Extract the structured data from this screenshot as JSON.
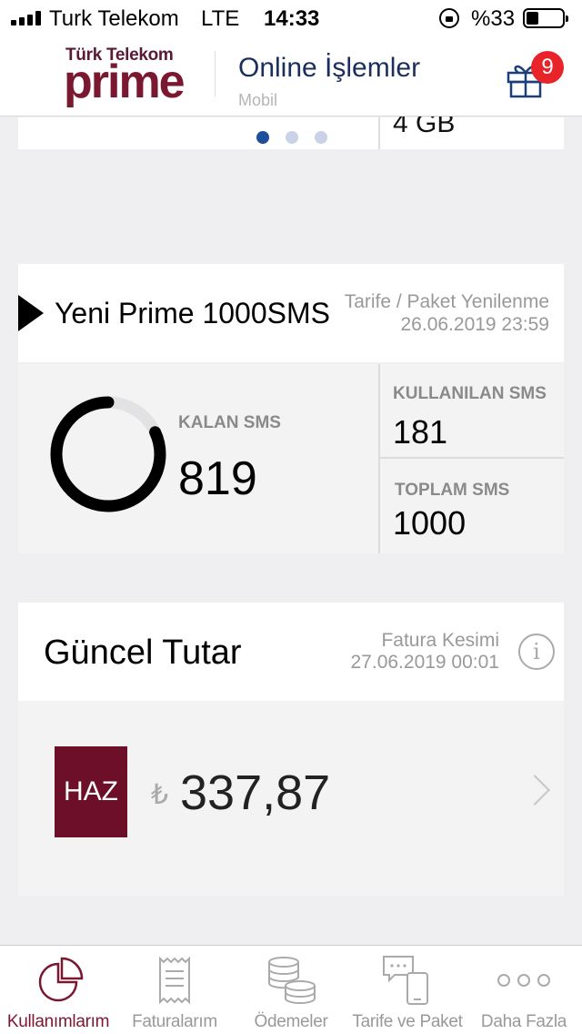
{
  "status_bar": {
    "carrier": "Turk Telekom",
    "network": "LTE",
    "time": "14:33",
    "battery": "%33",
    "battery_level": 0.33
  },
  "header": {
    "logo_top": "Türk Telekom",
    "logo_brand": "prime",
    "title": "Online İşlemler",
    "subtitle": "Mobil",
    "gift_count": "9"
  },
  "carousel": {
    "partial_value": "4 GB",
    "pages": 3,
    "active_page": 0
  },
  "sms_card": {
    "package_name": "Yeni Prime 1000SMS",
    "renewal_label": "Tarife / Paket Yenilenme",
    "renewal_date": "26.06.2019 23:59",
    "remaining_label": "KALAN SMS",
    "remaining_value": "819",
    "used_label": "KULLANILAN SMS",
    "used_value": "181",
    "total_label": "TOPLAM SMS",
    "total_value": "1000"
  },
  "bill_card": {
    "title": "Güncel Tutar",
    "cut_label": "Fatura Kesimi",
    "cut_date": "27.06.2019 00:01",
    "month": "HAZ",
    "currency": "₺",
    "amount": "337,87"
  },
  "tabs": [
    {
      "label": "Kullanımlarım",
      "icon": "pie-chart-icon",
      "active": true
    },
    {
      "label": "Faturalarım",
      "icon": "receipt-icon",
      "active": false
    },
    {
      "label": "Ödemeler",
      "icon": "coins-icon",
      "active": false
    },
    {
      "label": "Tarife ve Paket",
      "icon": "phone-chat-icon",
      "active": false
    },
    {
      "label": "Daha Fazla",
      "icon": "more-icon",
      "active": false
    }
  ],
  "colors": {
    "brand": "#7a1832",
    "badge": "#e8242a",
    "nav_title": "#1b2f5e",
    "dot_active": "#1f4f9a"
  }
}
